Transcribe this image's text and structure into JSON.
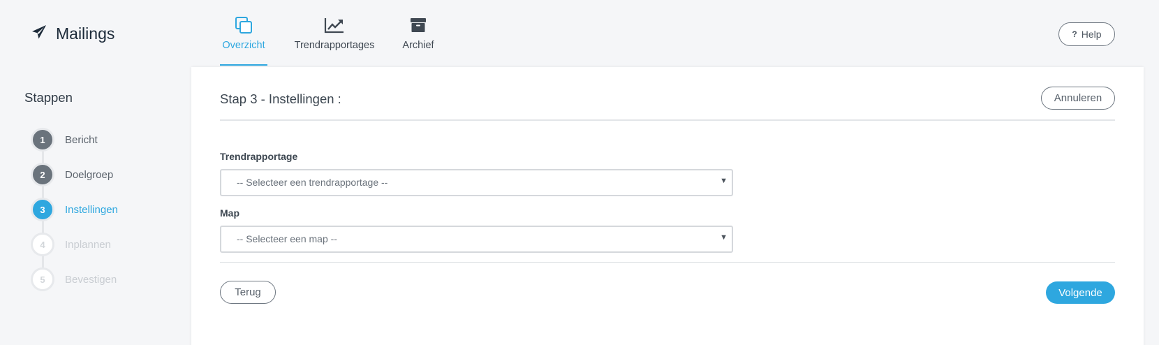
{
  "app": {
    "title": "Mailings",
    "icon": "paper-plane-icon"
  },
  "nav": {
    "items": [
      {
        "label": "Overzicht",
        "icon": "copy-icon",
        "active": true
      },
      {
        "label": "Trendrapportages",
        "icon": "line-chart-icon",
        "active": false
      },
      {
        "label": "Archief",
        "icon": "archive-box-icon",
        "active": false
      }
    ]
  },
  "help": {
    "label": "Help",
    "icon_text": "?"
  },
  "sidebar": {
    "title": "Stappen",
    "steps": [
      {
        "number": "1",
        "label": "Bericht",
        "state": "done"
      },
      {
        "number": "2",
        "label": "Doelgroep",
        "state": "done"
      },
      {
        "number": "3",
        "label": "Instellingen",
        "state": "active"
      },
      {
        "number": "4",
        "label": "Inplannen",
        "state": "pending"
      },
      {
        "number": "5",
        "label": "Bevestigen",
        "state": "pending"
      }
    ]
  },
  "main": {
    "title": "Stap 3 - Instellingen :",
    "cancel_label": "Annuleren",
    "fields": [
      {
        "label": "Trendrapportage",
        "placeholder": "-- Selecteer een trendrapportage --"
      },
      {
        "label": "Map",
        "placeholder": "-- Selecteer een map --"
      }
    ],
    "back_label": "Terug",
    "next_label": "Volgende"
  },
  "colors": {
    "accent": "#2ea7df",
    "brand_text": "#1d2b3a",
    "step_done": "#6a737c",
    "step_pending_text": "#c9cdd2",
    "background": "#f5f6f8"
  }
}
